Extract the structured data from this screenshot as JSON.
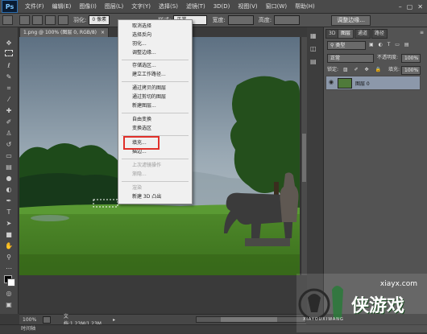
{
  "menubar": {
    "logo": "Ps",
    "items": [
      "文件(F)",
      "编辑(E)",
      "图像(I)",
      "图层(L)",
      "文字(Y)",
      "选择(S)",
      "滤镜(T)",
      "3D(D)",
      "视图(V)",
      "窗口(W)",
      "帮助(H)"
    ],
    "window_controls": [
      "–",
      "▢",
      "✕"
    ]
  },
  "options": {
    "feather_label": "羽化:",
    "feather_value": "0 像素",
    "style_label": "样式:",
    "style_value": "正常",
    "width_label": "宽度:",
    "height_label": "高度:",
    "refine_button": "调整边缘..."
  },
  "document": {
    "tab_title": "1.png @ 100% (图层 0, RGB/8)",
    "tab_close": "×"
  },
  "context_menu": {
    "items": [
      {
        "label": "取消选择",
        "disabled": false
      },
      {
        "label": "选择反向",
        "disabled": false
      },
      {
        "label": "羽化...",
        "disabled": false
      },
      {
        "label": "调整边缘...",
        "disabled": false
      },
      {
        "label": "存储选区...",
        "disabled": false
      },
      {
        "label": "建立工作路径...",
        "disabled": false
      },
      {
        "label": "通过拷贝的图层",
        "disabled": false
      },
      {
        "label": "通过剪切的图层",
        "disabled": false
      },
      {
        "label": "新建图层...",
        "disabled": false
      },
      {
        "label": "自由变换",
        "disabled": false
      },
      {
        "label": "变换选区",
        "disabled": false
      },
      {
        "label": "填充...",
        "disabled": false
      },
      {
        "label": "描边...",
        "disabled": false
      },
      {
        "label": "上次滤镜操作",
        "disabled": true
      },
      {
        "label": "渐隐...",
        "disabled": true
      },
      {
        "label": "渲染",
        "disabled": true
      },
      {
        "label": "新建 3D 凸出",
        "disabled": false
      }
    ],
    "highlight_color": "#e0302a"
  },
  "status": {
    "zoom": "100%",
    "doc_info": "文档:1.23M/1.23M"
  },
  "timeline": {
    "label": "时间轴"
  },
  "layers_panel": {
    "tabs": [
      "3D",
      "图层",
      "通道",
      "路径"
    ],
    "kind_label": "类型",
    "blend_mode": "正常",
    "opacity_label": "不透明度:",
    "opacity_value": "100%",
    "lock_label": "锁定:",
    "fill_label": "填充:",
    "fill_value": "100%",
    "layer_name": "图层 0"
  },
  "watermark": {
    "site": "xiayx.com",
    "brand": "侠游戏",
    "sub": "XIAYOUXIWANG"
  }
}
